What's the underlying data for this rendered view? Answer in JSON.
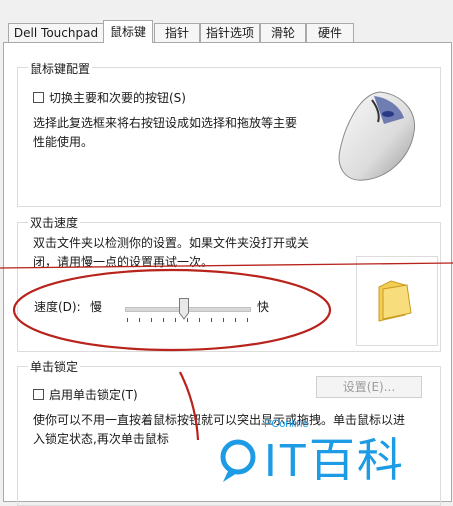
{
  "tabs": [
    "Dell Touchpad",
    "鼠标键",
    "指针",
    "指针选项",
    "滑轮",
    "硬件"
  ],
  "button_config": {
    "title": "鼠标键配置",
    "switch_checkbox_label": "切换主要和次要的按钮(S)",
    "description_line1": "选择此复选框来将右按钮设成如选择和拖放等主要",
    "description_line2": "性能使用。"
  },
  "double_click": {
    "title": "双击速度",
    "description_line1": "双击文件夹以检测你的设置。如果文件夹没打开或关",
    "description_line2": "闭，请用慢一点的设置再试一次。",
    "speed_label": "速度(D):",
    "slow_label": "慢",
    "fast_label": "快",
    "speed_level": 0.45
  },
  "click_lock": {
    "title": "单击锁定",
    "enable_checkbox_label": "启用单击锁定(T)",
    "settings_button": "设置(E)...",
    "description_line1": "使你可以不用一直按着鼠标按钮就可以突出显示或拖拽。单击鼠标以进",
    "description_line2": "入锁定状态,再次单击鼠标"
  },
  "watermark": {
    "site": "PConline",
    "brand": "IT百科"
  },
  "colors": {
    "annotation_red": "#b8231c",
    "watermark_blue": "#1e9be5"
  }
}
